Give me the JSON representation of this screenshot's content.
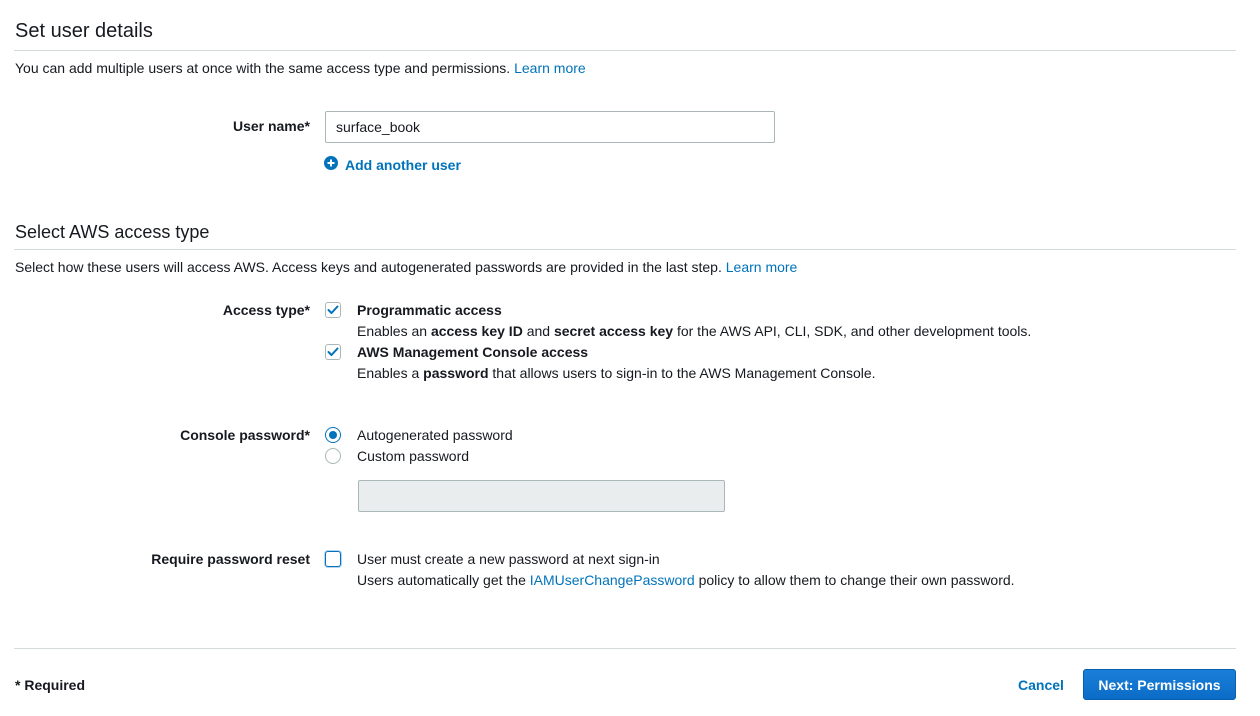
{
  "user_details": {
    "title": "Set user details",
    "description": "You can add multiple users at once with the same access type and permissions.",
    "learn_more": "Learn more",
    "user_name_label": "User name*",
    "user_name_value": "surface_book",
    "add_another_user": "Add another user"
  },
  "access_type_section": {
    "title": "Select AWS access type",
    "description": "Select how these users will access AWS. Access keys and autogenerated passwords are provided in the last step.",
    "learn_more": "Learn more",
    "access_type_label": "Access type*",
    "programmatic": {
      "title": "Programmatic access",
      "desc_pre": "Enables an ",
      "desc_b1": "access key ID",
      "desc_mid": " and ",
      "desc_b2": "secret access key",
      "desc_post": " for the AWS API, CLI, SDK, and other development tools.",
      "checked": true
    },
    "console": {
      "title": "AWS Management Console access",
      "desc_pre": "Enables a ",
      "desc_b1": "password",
      "desc_post": " that allows users to sign-in to the AWS Management Console.",
      "checked": true
    }
  },
  "console_password": {
    "label": "Console password*",
    "options": [
      "Autogenerated password",
      "Custom password"
    ],
    "selected": "Autogenerated password",
    "custom_value": ""
  },
  "password_reset": {
    "label": "Require password reset",
    "option": "User must create a new password at next sign-in",
    "desc_pre": "Users automatically get the ",
    "desc_link": "IAMUserChangePassword",
    "desc_post": " policy to allow them to change their own password.",
    "checked": false
  },
  "footer": {
    "required_note": "* Required",
    "cancel": "Cancel",
    "next": "Next: Permissions"
  },
  "colors": {
    "link": "#0073bb",
    "primary_button": "#0b6cc7",
    "divider": "#d5dbdb"
  }
}
